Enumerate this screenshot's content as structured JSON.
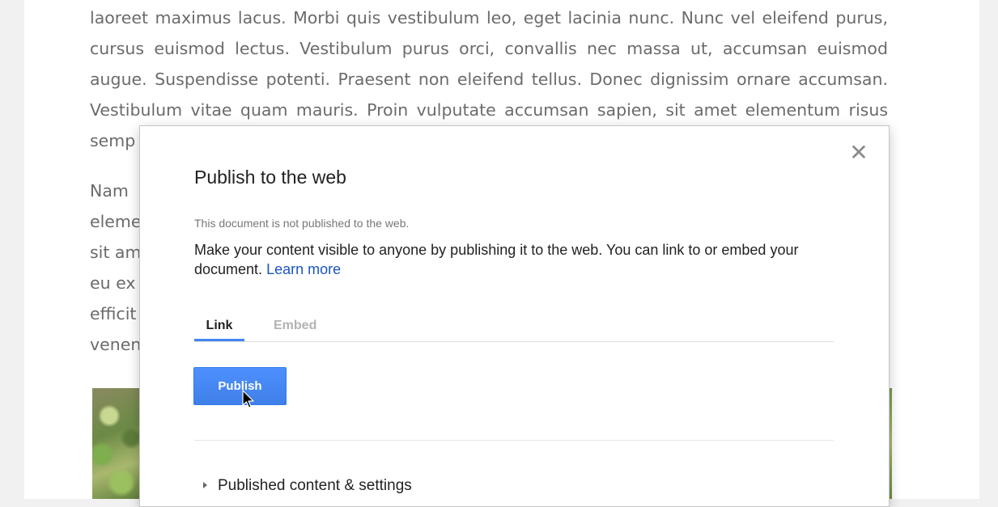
{
  "document": {
    "paragraph1_lines": [
      "laoreet maximus lacus. Morbi quis vestibulum leo, eget lacinia nunc. Nunc vel eleifend purus,",
      "cursus euismod lectus. Vestibulum purus orci, convallis nec massa ut, accumsan euismod",
      "augue. Suspendisse potenti. Praesent non eleifend tellus. Donec dignissim ornare accumsan.",
      "Vestibulum vitae quam mauris. Proin vulputate accumsan sapien, sit amet elementum risus",
      "semp"
    ],
    "paragraph2_lines": [
      "Nam",
      "eleme",
      "sit am",
      "eu ex",
      "efficit",
      "venen"
    ]
  },
  "dialog": {
    "close_glyph": "✕",
    "title": "Publish to the web",
    "status": "This document is not published to the web.",
    "description": "Make your content visible to anyone by publishing it to the web. You can link to or embed your document.",
    "learn_more": "Learn more",
    "tabs": [
      {
        "label": "Link",
        "active": true
      },
      {
        "label": "Embed",
        "active": false
      }
    ],
    "publish_button": "Publish",
    "published_settings": "Published content & settings"
  },
  "colors": {
    "accent": "#4285f4",
    "button": "#4d90fe",
    "link": "#1a55c4"
  },
  "icons": {
    "close": "close-icon",
    "expand": "triangle-right-icon",
    "pointer": "mouse-cursor-icon"
  }
}
